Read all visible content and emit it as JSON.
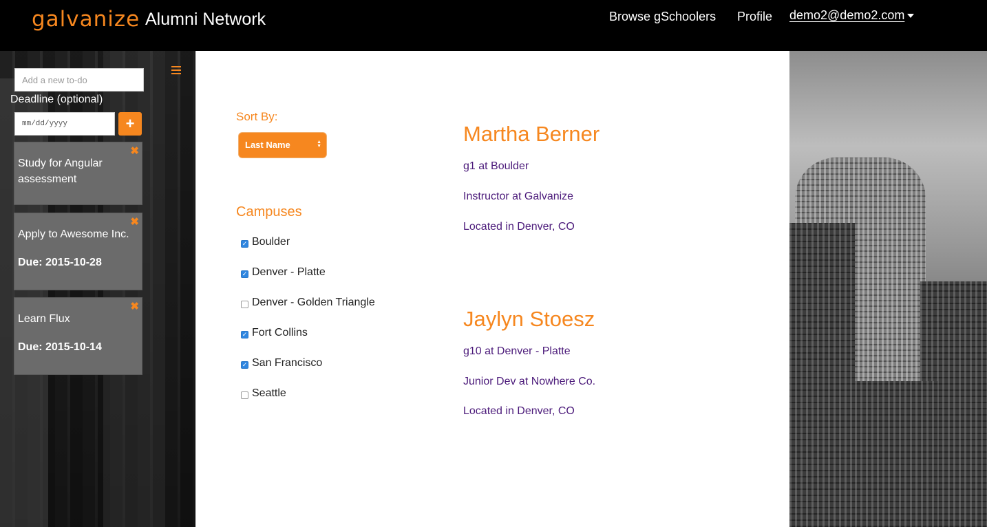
{
  "navbar": {
    "brand": "galvanize",
    "app_title": "Alumni Network",
    "links": {
      "browse": "Browse gSchoolers",
      "profile": "Profile",
      "user": "demo2@demo2.com"
    }
  },
  "sidebar": {
    "todo_placeholder": "Add a new to-do",
    "deadline_label": "Deadline (optional)",
    "date_placeholder": "mm/dd/yyyy",
    "add_button": "+",
    "todos": [
      {
        "title": "Study for Angular assessment",
        "due": ""
      },
      {
        "title": "Apply to Awesome Inc.",
        "due": "Due: 2015-10-28"
      },
      {
        "title": "Learn Flux",
        "due": "Due: 2015-10-14"
      }
    ]
  },
  "filters": {
    "sort_label": "Sort By:",
    "sort_value": "Last Name",
    "campuses_label": "Campuses",
    "campuses": [
      {
        "name": "Boulder",
        "checked": true
      },
      {
        "name": "Denver - Platte",
        "checked": true
      },
      {
        "name": "Denver - Golden Triangle",
        "checked": false
      },
      {
        "name": "Fort Collins",
        "checked": true
      },
      {
        "name": "San Francisco",
        "checked": true
      },
      {
        "name": "Seattle",
        "checked": false
      }
    ]
  },
  "alumni": [
    {
      "name": "Martha Berner",
      "cohort": "g1 at Boulder",
      "job": "Instructor at Galvanize",
      "location": "Located in Denver, CO"
    },
    {
      "name": "Jaylyn Stoesz",
      "cohort": "g10 at Denver - Platte",
      "job": "Junior Dev at Nowhere Co.",
      "location": "Located in Denver, CO"
    }
  ],
  "colors": {
    "accent": "#f6871f",
    "alumni_text": "#4b1a7a",
    "checkbox": "#2f86e0"
  }
}
